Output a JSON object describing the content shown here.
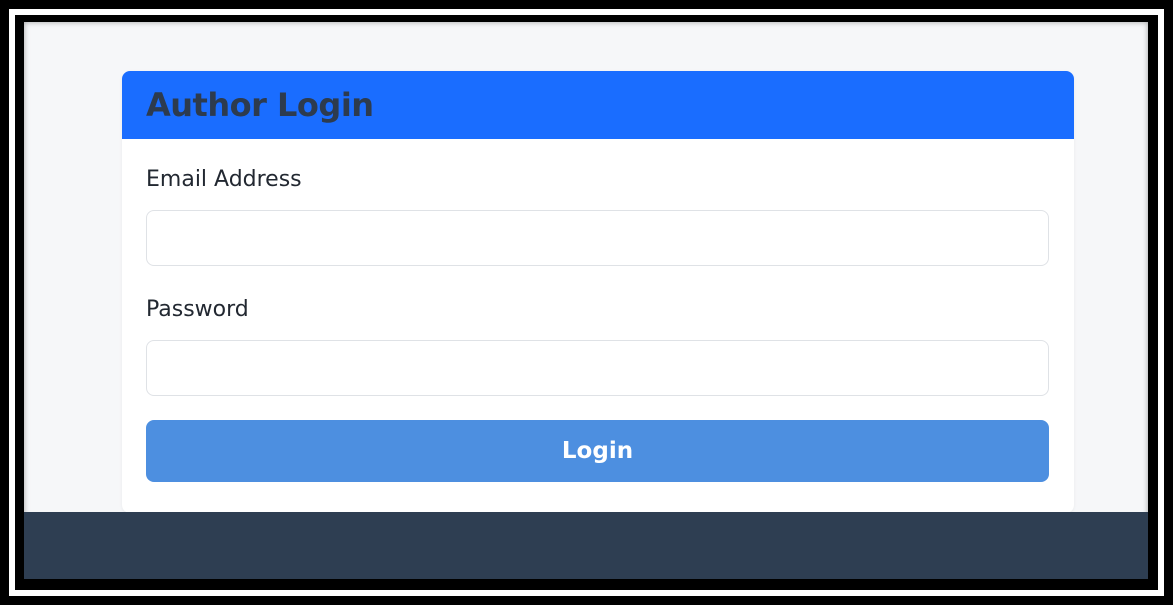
{
  "login_card": {
    "title": "Author Login",
    "email": {
      "label": "Email Address",
      "value": "",
      "placeholder": ""
    },
    "password": {
      "label": "Password",
      "value": "",
      "placeholder": ""
    },
    "submit_label": "Login"
  },
  "colors": {
    "header_bg": "#1a6dff",
    "button_bg": "#4d8fe0",
    "footer_bg": "#2e3e52",
    "page_bg": "#f6f7f9"
  }
}
